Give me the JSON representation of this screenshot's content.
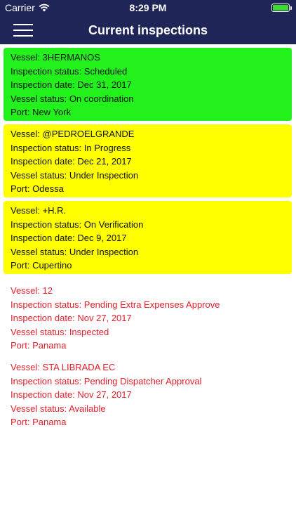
{
  "status_bar": {
    "carrier": "Carrier",
    "time": "8:29 PM"
  },
  "header": {
    "title": "Current inspections"
  },
  "inspections": [
    {
      "color": "#22f11c",
      "vessel": "Vessel: 3HERMANOS",
      "inspection_status": "Inspection status: Scheduled",
      "inspection_date": "Inspection date: Dec 31, 2017",
      "vessel_status": "Vessel status: On coordination",
      "port": "Port: New York"
    },
    {
      "color": "#ffff00",
      "vessel": "Vessel: @PEDROELGRANDE",
      "inspection_status": "Inspection status: In Progress",
      "inspection_date": "Inspection date: Dec 21, 2017",
      "vessel_status": "Vessel status: Under Inspection",
      "port": "Port: Odessa"
    },
    {
      "color": "#ffff00",
      "vessel": "Vessel: +H.R.",
      "inspection_status": "Inspection status: On Verification",
      "inspection_date": "Inspection date: Dec 9, 2017",
      "vessel_status": "Vessel status: Under Inspection",
      "port": "Port: Cupertino"
    },
    {
      "color": "#e0212b",
      "vessel": "Vessel: 12",
      "inspection_status": "Inspection status: Pending Extra Expenses Approve",
      "inspection_date": "Inspection date: Nov 27, 2017",
      "vessel_status": "Vessel status: Inspected",
      "port": "Port: Panama"
    },
    {
      "color": "#e0212b",
      "vessel": "Vessel: STA LIBRADA EC",
      "inspection_status": "Inspection status: Pending Dispatcher Approval",
      "inspection_date": "Inspection date: Nov 27, 2017",
      "vessel_status": "Vessel status: Available",
      "port": "Port: Panama"
    }
  ]
}
